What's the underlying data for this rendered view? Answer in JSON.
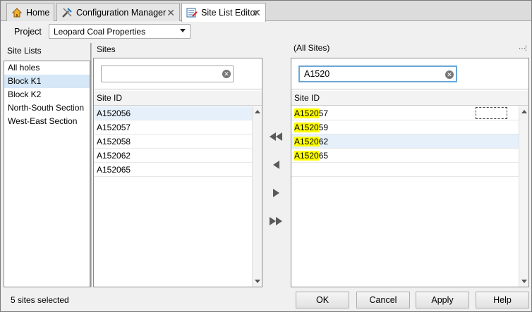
{
  "tabs": [
    {
      "label": "Home",
      "icon": "home-icon"
    },
    {
      "label": "Configuration Manager",
      "icon": "tools-icon",
      "close": "✕"
    },
    {
      "label": "Site List Editor",
      "icon": "editor-icon",
      "close": "✕"
    }
  ],
  "project": {
    "label": "Project",
    "value": "Leopard Coal Properties"
  },
  "site_lists": {
    "title": "Site Lists",
    "items": [
      "All holes",
      "Block K1",
      "Block K2",
      "North-South Section",
      "West-East Section"
    ],
    "selected_index": 1
  },
  "sites": {
    "title": "Sites",
    "search_value": "",
    "column": "Site ID",
    "rows": [
      "A152056",
      "A152057",
      "A152058",
      "A152062",
      "A152065"
    ]
  },
  "all_sites": {
    "title": "(All Sites)",
    "search_value": "A1520",
    "column": "Site ID",
    "rows": [
      {
        "match": "A1520",
        "rest": "57"
      },
      {
        "match": "A1520",
        "rest": "59"
      },
      {
        "match": "A1520",
        "rest": "62"
      },
      {
        "match": "A1520",
        "rest": "65"
      }
    ]
  },
  "move_buttons": [
    "remove-all",
    "remove-one",
    "add-one",
    "add-all"
  ],
  "status": "5 sites selected",
  "buttons": {
    "ok": "OK",
    "cancel": "Cancel",
    "apply": "Apply",
    "help": "Help"
  },
  "colors": {
    "highlight": "#ffff00",
    "selection": "#d6e8f8",
    "focus": "#6aa6d8"
  }
}
